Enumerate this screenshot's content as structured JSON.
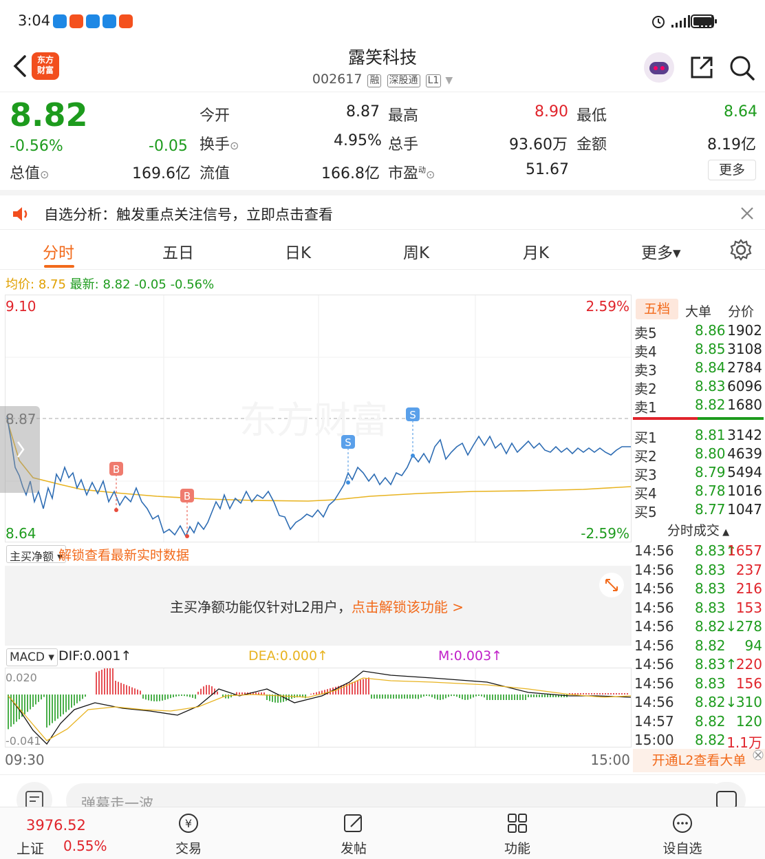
{
  "status": {
    "time": "3:04"
  },
  "header": {
    "stock_name": "露笑科技",
    "stock_code": "002617",
    "tags": [
      "融",
      "深股通",
      "L1"
    ],
    "logo_text": "东方财富"
  },
  "quote": {
    "price": "8.82",
    "change_pct": "-0.56%",
    "change": "-0.05",
    "open_label": "今开",
    "open": "8.87",
    "high_label": "最高",
    "high": "8.90",
    "low_label": "最低",
    "low": "8.64",
    "turnover_label": "换手",
    "turnover": "4.95%",
    "volume_label": "总手",
    "volume": "93.60万",
    "amount_label": "金额",
    "amount": "8.19亿",
    "mktcap_label": "总值",
    "mktcap": "169.6亿",
    "float_label": "流值",
    "float_cap": "166.8亿",
    "pe_label": "市盈",
    "pe_sup": "动",
    "pe": "51.67",
    "more_button": "更多"
  },
  "notice": {
    "text": "自选分析：触发重点关注信号，立即点击查看"
  },
  "tabs": [
    {
      "label": "分时"
    },
    {
      "label": "五日"
    },
    {
      "label": "日K"
    },
    {
      "label": "周K"
    },
    {
      "label": "月K"
    },
    {
      "label": "更多▾"
    }
  ],
  "avg_line": {
    "avg_label": "均价:",
    "avg": "8.75",
    "latest_label": "最新:",
    "latest": "8.82",
    "change": "-0.05",
    "change_pct": "-0.56%"
  },
  "chart_data": {
    "type": "line",
    "y_top": "9.10",
    "y_mid": "8.87",
    "y_bottom": "8.64",
    "pct_top": "2.59%",
    "pct_bottom": "-2.59%",
    "watermark": "东方财富",
    "x_start": "09:30",
    "x_end": "15:00",
    "marker_buy": "B",
    "marker_sell": "S"
  },
  "orderbook": {
    "tabs": [
      "五档",
      "大单",
      "分价"
    ],
    "asks": [
      {
        "label": "卖5",
        "price": "8.86",
        "vol": "1902"
      },
      {
        "label": "卖4",
        "price": "8.85",
        "vol": "3108"
      },
      {
        "label": "卖3",
        "price": "8.84",
        "vol": "2784"
      },
      {
        "label": "卖2",
        "price": "8.83",
        "vol": "6096"
      },
      {
        "label": "卖1",
        "price": "8.82",
        "vol": "1680"
      }
    ],
    "bids": [
      {
        "label": "买1",
        "price": "8.81",
        "vol": "3142"
      },
      {
        "label": "买2",
        "price": "8.80",
        "vol": "4639"
      },
      {
        "label": "买3",
        "price": "8.79",
        "vol": "5494"
      },
      {
        "label": "买4",
        "price": "8.78",
        "vol": "1016"
      },
      {
        "label": "买5",
        "price": "8.77",
        "vol": "1047"
      }
    ]
  },
  "trades": {
    "title": "分时成交",
    "rows": [
      {
        "time": "14:56",
        "price": "8.83↑",
        "vol": "1657",
        "color": "red"
      },
      {
        "time": "14:56",
        "price": "8.83",
        "vol": "237",
        "color": "red"
      },
      {
        "time": "14:56",
        "price": "8.83",
        "vol": "216",
        "color": "red"
      },
      {
        "time": "14:56",
        "price": "8.83",
        "vol": "153",
        "color": "red"
      },
      {
        "time": "14:56",
        "price": "8.82↓",
        "vol": "278",
        "color": "green"
      },
      {
        "time": "14:56",
        "price": "8.82",
        "vol": "94",
        "color": "green"
      },
      {
        "time": "14:56",
        "price": "8.83↑",
        "vol": "220",
        "color": "red"
      },
      {
        "time": "14:56",
        "price": "8.83",
        "vol": "156",
        "color": "red"
      },
      {
        "time": "14:56",
        "price": "8.82↓",
        "vol": "310",
        "color": "green"
      },
      {
        "time": "14:57",
        "price": "8.82",
        "vol": "120",
        "color": "green"
      },
      {
        "time": "15:00",
        "price": "8.82",
        "vol": "1.1万",
        "color": "red"
      }
    ],
    "l2_button": "开通L2查看大单"
  },
  "netflow": {
    "selector": "主买净额",
    "unlock_text": "解锁查看最新实时数据",
    "message": "主买净额功能仅针对L2用户，",
    "link": "点击解锁该功能 >"
  },
  "macd": {
    "selector": "MACD",
    "dif": "DIF:0.001↑",
    "dea": "DEA:0.000↑",
    "m": "M:0.003↑",
    "top": "0.020",
    "bottom": "-0.041"
  },
  "comment": {
    "placeholder": "弹幕走一波..."
  },
  "bottom_nav": {
    "index_value": "3976.52",
    "index_name": "上证",
    "index_change": "0.55%",
    "items": [
      {
        "label": "交易"
      },
      {
        "label": "发帖"
      },
      {
        "label": "功能"
      },
      {
        "label": "设自选"
      }
    ]
  }
}
